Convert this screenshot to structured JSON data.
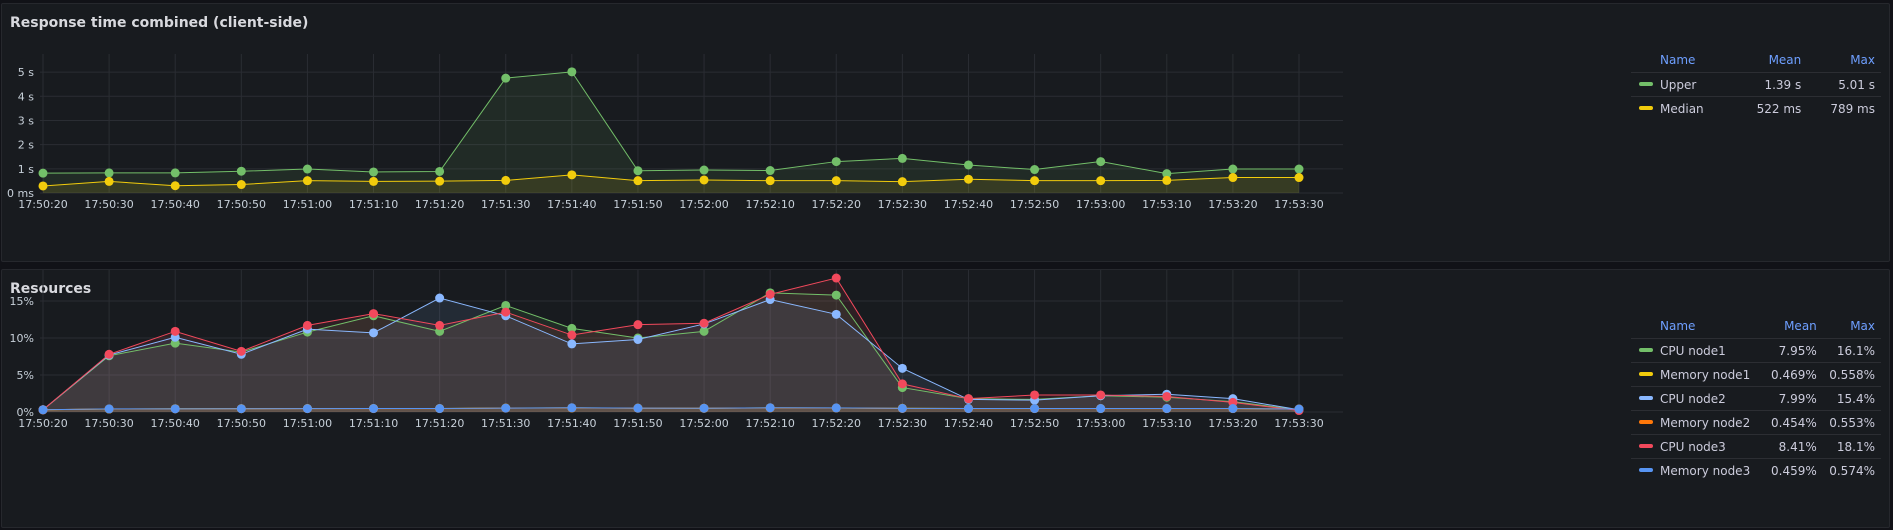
{
  "panels": [
    {
      "title": "Response time combined (client-side)",
      "legend": {
        "headers": [
          "Name",
          "Mean",
          "Max"
        ],
        "rows": [
          {
            "name": "Upper",
            "color": "#73bf69",
            "mean": "1.39 s",
            "max": "5.01 s"
          },
          {
            "name": "Median",
            "color": "#f2cc0c",
            "mean": "522 ms",
            "max": "789 ms"
          }
        ]
      }
    },
    {
      "title": "Resources",
      "legend": {
        "headers": [
          "Name",
          "Mean",
          "Max"
        ],
        "rows": [
          {
            "name": "CPU node1",
            "color": "#73bf69",
            "mean": "7.95%",
            "max": "16.1%"
          },
          {
            "name": "Memory node1",
            "color": "#f2cc0c",
            "mean": "0.469%",
            "max": "0.558%"
          },
          {
            "name": "CPU node2",
            "color": "#8ab8ff",
            "mean": "7.99%",
            "max": "15.4%"
          },
          {
            "name": "Memory node2",
            "color": "#ff780a",
            "mean": "0.454%",
            "max": "0.553%"
          },
          {
            "name": "CPU node3",
            "color": "#f2495c",
            "mean": "8.41%",
            "max": "18.1%"
          },
          {
            "name": "Memory node3",
            "color": "#5794f2",
            "mean": "0.459%",
            "max": "0.574%"
          }
        ]
      }
    }
  ],
  "chart_data": [
    {
      "type": "line",
      "title": "Response time combined (client-side)",
      "x": [
        "17:50:20",
        "17:50:30",
        "17:50:40",
        "17:50:50",
        "17:51:00",
        "17:51:10",
        "17:51:20",
        "17:51:30",
        "17:51:40",
        "17:51:50",
        "17:52:00",
        "17:52:10",
        "17:52:20",
        "17:52:30",
        "17:52:40",
        "17:52:50",
        "17:53:00",
        "17:53:10",
        "17:53:20",
        "17:53:30"
      ],
      "y_unit": "s",
      "ylim": [
        0,
        5.5
      ],
      "y_ticks": [
        0,
        1,
        2,
        3,
        4,
        5
      ],
      "y_tick_labels": [
        "0 ms",
        "1 s",
        "2 s",
        "3 s",
        "4 s",
        "5 s"
      ],
      "grid": true,
      "legend_position": "right",
      "series": [
        {
          "name": "Upper",
          "color": "#73bf69",
          "values": [
            0.82,
            0.83,
            0.83,
            0.9,
            0.99,
            0.87,
            0.89,
            4.75,
            5.01,
            0.92,
            0.95,
            0.93,
            1.3,
            1.43,
            1.16,
            0.97,
            1.3,
            0.8,
            0.99,
            0.99
          ]
        },
        {
          "name": "Median",
          "color": "#f2cc0c",
          "values": [
            0.29,
            0.48,
            0.3,
            0.35,
            0.51,
            0.48,
            0.49,
            0.52,
            0.75,
            0.51,
            0.54,
            0.51,
            0.51,
            0.47,
            0.57,
            0.51,
            0.51,
            0.52,
            0.64,
            0.64
          ]
        }
      ]
    },
    {
      "type": "line",
      "title": "Resources",
      "x": [
        "17:50:20",
        "17:50:30",
        "17:50:40",
        "17:50:50",
        "17:51:00",
        "17:51:10",
        "17:51:20",
        "17:51:30",
        "17:51:40",
        "17:51:50",
        "17:52:00",
        "17:52:10",
        "17:52:20",
        "17:52:30",
        "17:52:40",
        "17:52:50",
        "17:53:00",
        "17:53:10",
        "17:53:20",
        "17:53:30"
      ],
      "y_unit": "%",
      "ylim": [
        0,
        20
      ],
      "y_ticks": [
        0,
        5,
        10,
        15,
        20
      ],
      "y_tick_labels": [
        "0%",
        "5%",
        "10%",
        "15%",
        "20%"
      ],
      "grid": true,
      "legend_position": "right",
      "series": [
        {
          "name": "CPU node1",
          "color": "#73bf69",
          "values": [
            0.3,
            7.6,
            9.3,
            8.1,
            10.8,
            13.0,
            10.9,
            14.4,
            11.3,
            10.0,
            10.9,
            16.1,
            15.8,
            3.3,
            1.8,
            1.7,
            2.2,
            2.0,
            1.4,
            0.3
          ]
        },
        {
          "name": "Memory node1",
          "color": "#f2cc0c",
          "values": [
            0.3,
            0.4,
            0.44,
            0.45,
            0.47,
            0.48,
            0.48,
            0.54,
            0.55,
            0.52,
            0.5,
            0.56,
            0.54,
            0.5,
            0.48,
            0.47,
            0.47,
            0.47,
            0.47,
            0.4
          ]
        },
        {
          "name": "CPU node2",
          "color": "#8ab8ff",
          "values": [
            0.3,
            7.7,
            10.1,
            7.8,
            11.2,
            10.7,
            15.4,
            13.0,
            9.2,
            9.8,
            11.9,
            15.2,
            13.2,
            5.9,
            1.7,
            1.6,
            2.2,
            2.4,
            1.8,
            0.3
          ]
        },
        {
          "name": "Memory node2",
          "color": "#ff780a",
          "values": [
            0.3,
            0.4,
            0.43,
            0.44,
            0.45,
            0.46,
            0.46,
            0.52,
            0.55,
            0.51,
            0.5,
            0.55,
            0.54,
            0.48,
            0.46,
            0.46,
            0.46,
            0.46,
            0.46,
            0.4
          ]
        },
        {
          "name": "CPU node3",
          "color": "#f2495c",
          "values": [
            0.3,
            7.8,
            10.9,
            8.2,
            11.7,
            13.3,
            11.7,
            13.5,
            10.4,
            11.8,
            12.0,
            15.9,
            18.1,
            3.8,
            1.8,
            2.3,
            2.3,
            2.1,
            1.3,
            0.2
          ]
        },
        {
          "name": "Memory node3",
          "color": "#5794f2",
          "values": [
            0.3,
            0.42,
            0.43,
            0.44,
            0.46,
            0.47,
            0.47,
            0.53,
            0.57,
            0.52,
            0.51,
            0.57,
            0.55,
            0.49,
            0.47,
            0.47,
            0.47,
            0.47,
            0.47,
            0.4
          ]
        }
      ]
    }
  ]
}
